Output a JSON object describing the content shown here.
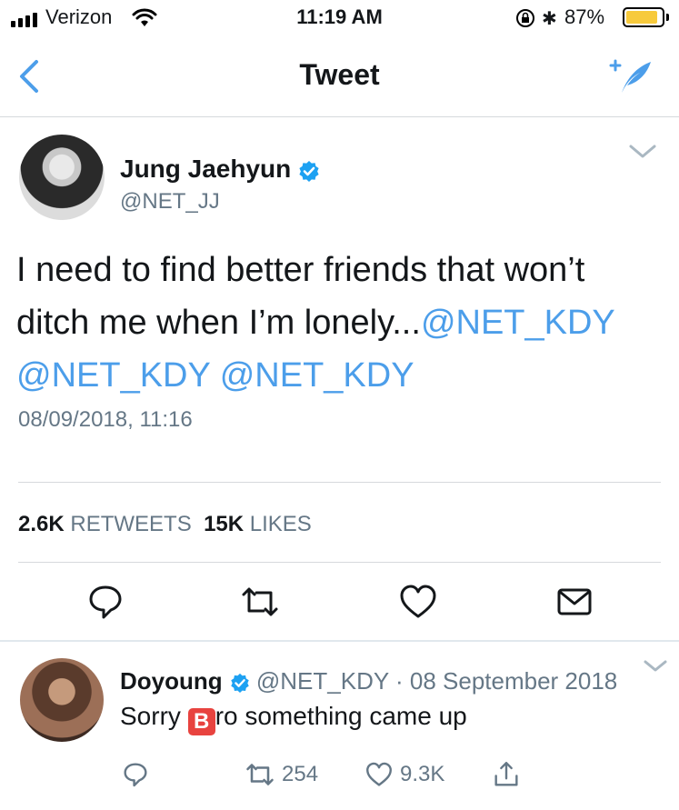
{
  "status_bar": {
    "carrier": "Verizon",
    "time": "11:19 AM",
    "battery_percent": "87%",
    "battery_level": 0.87,
    "battery_color": "#f7ca3c"
  },
  "nav": {
    "title": "Tweet",
    "back_icon": "chevron-left-icon",
    "compose_icon": "compose-tweet-icon"
  },
  "tweet": {
    "author_name": "Jung Jaehyun",
    "author_handle": "@NET_JJ",
    "verified": true,
    "text_plain": "I need to find better friends that won’t ditch me when I’m lonely...",
    "mentions": [
      "@NET_KDY",
      "@NET_KDY",
      "@NET_KDY"
    ],
    "timestamp": "08/09/2018, 11:16",
    "retweets_count": "2.6K",
    "retweets_label": "RETWEETS",
    "likes_count": "15K",
    "likes_label": "LIKES",
    "actions": [
      "reply-icon",
      "retweet-icon",
      "like-icon",
      "message-icon"
    ]
  },
  "reply": {
    "author_name": "Doyoung",
    "author_handle": "@NET_KDY",
    "separator": "·",
    "date": "08 September 2018",
    "text_before": "Sorry ",
    "emoji_letter": "B",
    "text_after": "ro something came up",
    "retweets": "254",
    "likes": "9.3K"
  },
  "colors": {
    "accent": "#4c9eea",
    "secondary_text": "#657786",
    "primary_text": "#14171a",
    "verified_badge": "#1da1f2"
  }
}
